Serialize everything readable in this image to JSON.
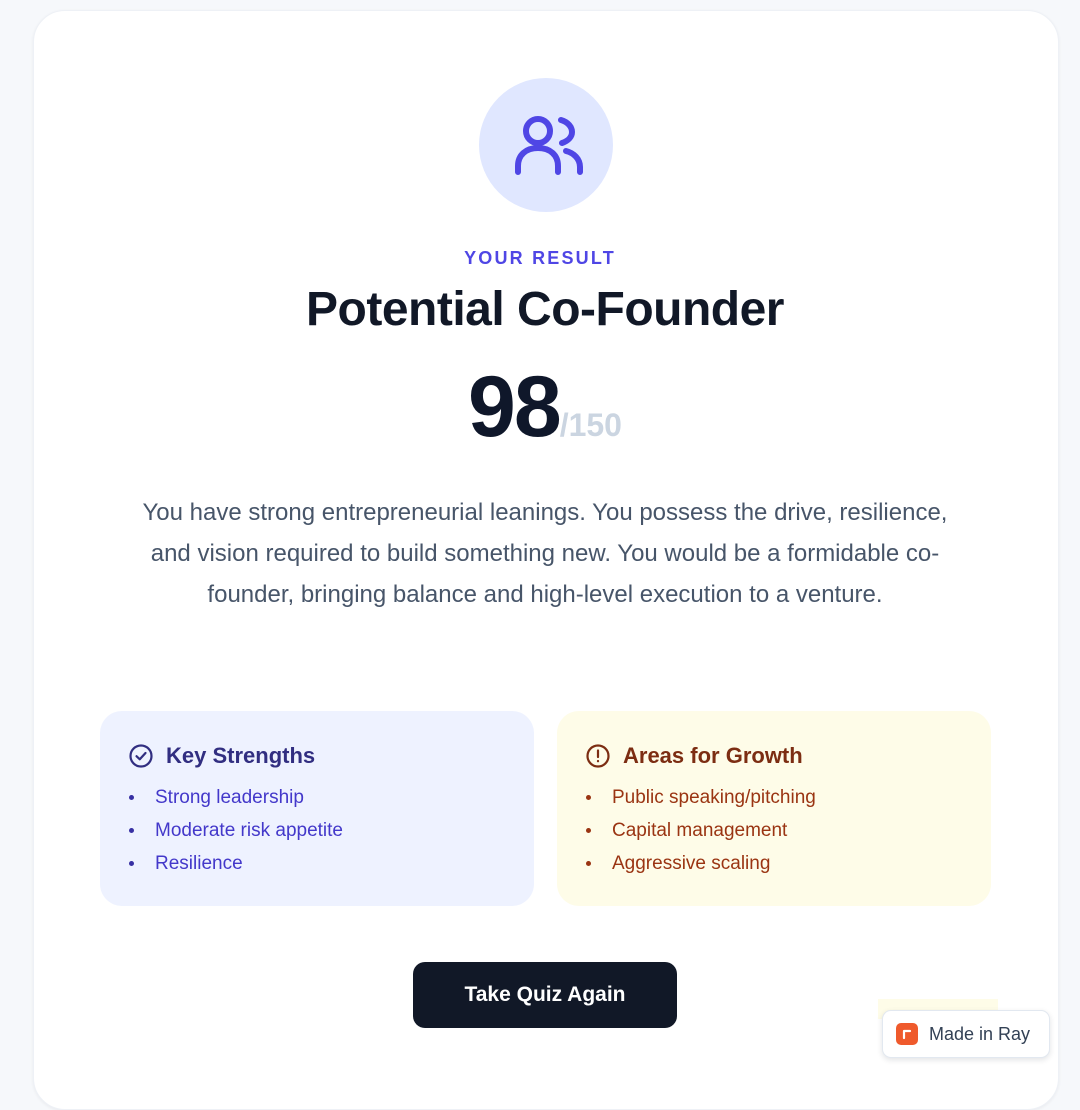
{
  "result": {
    "eyebrow": "YOUR RESULT",
    "title": "Potential Co-Founder",
    "score": "98",
    "score_max": "/150",
    "description": "You have strong entrepreneurial leanings. You possess the drive, resilience, and vision required to build something new. You would be a formidable co-founder, bringing balance and high-level execution to a venture."
  },
  "strengths": {
    "title": "Key Strengths",
    "items": [
      "Strong leadership",
      "Moderate risk appetite",
      "Resilience"
    ]
  },
  "growth": {
    "title": "Areas for Growth",
    "items": [
      "Public speaking/pitching",
      "Capital management",
      "Aggressive scaling"
    ]
  },
  "actions": {
    "retake_label": "Take Quiz Again"
  },
  "badge": {
    "label": "Made in Ray"
  },
  "icons": {
    "result": "users-icon",
    "strengths": "check-circle-icon",
    "growth": "alert-circle-icon",
    "badge": "ray-logo-icon"
  },
  "colors": {
    "accent": "#4f46e5",
    "strengths_bg": "#eef2ff",
    "growth_bg": "#fefce8",
    "button_bg": "#111827"
  }
}
